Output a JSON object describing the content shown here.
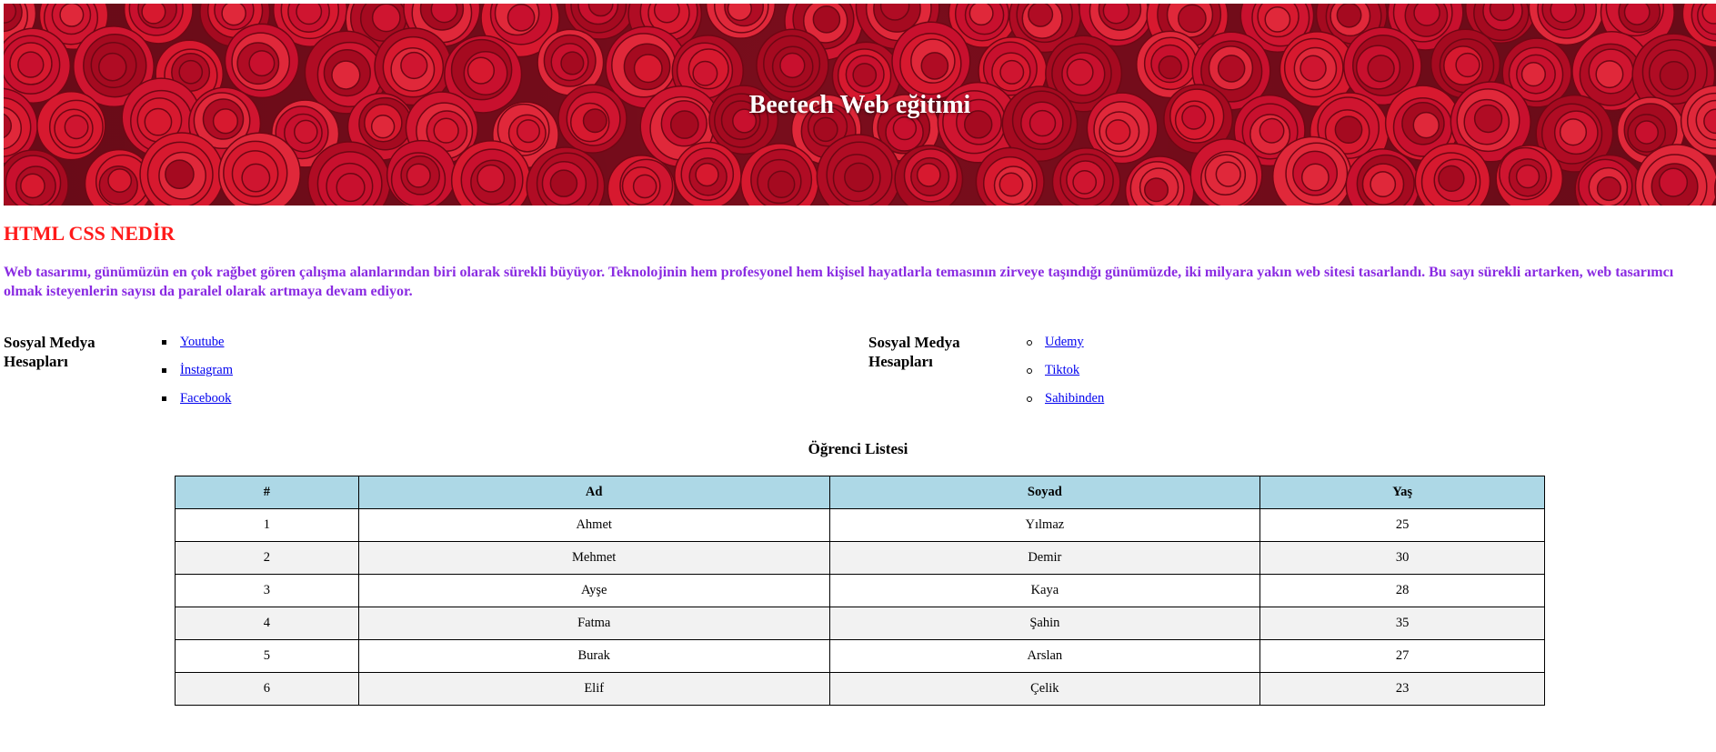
{
  "hero": {
    "title": "Beetech Web eğitimi"
  },
  "section": {
    "heading": "HTML CSS NEDİR",
    "paragraph": "Web tasarımı, günümüzün en çok rağbet gören çalışma alanlarından biri olarak sürekli büyüyor. Teknolojinin hem profesyonel hem kişisel hayatlarla temasının zirveye taşındığı günümüzde, iki milyara yakın web sitesi tasarlandı. Bu sayı sürekli artarken, web tasarımcı olmak isteyenlerin sayısı da paralel olarak artmaya devam ediyor."
  },
  "social_left": {
    "label": "Sosyal Medya Hesapları",
    "links": [
      "Youtube",
      "İnstagram",
      "Facebook"
    ]
  },
  "social_right": {
    "label": "Sosyal Medya Hesapları",
    "links": [
      "Udemy",
      "Tiktok",
      "Sahibinden"
    ]
  },
  "table": {
    "caption": "Öğrenci Listesi",
    "headers": [
      "#",
      "Ad",
      "Soyad",
      "Yaş"
    ],
    "rows": [
      [
        "1",
        "Ahmet",
        "Yılmaz",
        "25"
      ],
      [
        "2",
        "Mehmet",
        "Demir",
        "30"
      ],
      [
        "3",
        "Ayşe",
        "Kaya",
        "28"
      ],
      [
        "4",
        "Fatma",
        "Şahin",
        "35"
      ],
      [
        "5",
        "Burak",
        "Arslan",
        "27"
      ],
      [
        "6",
        "Elif",
        "Çelik",
        "23"
      ]
    ]
  },
  "colors": {
    "heading": "#ff1a1a",
    "paragraph": "#8a2be2",
    "table_header": "#add8e6",
    "link": "#0000ee"
  }
}
